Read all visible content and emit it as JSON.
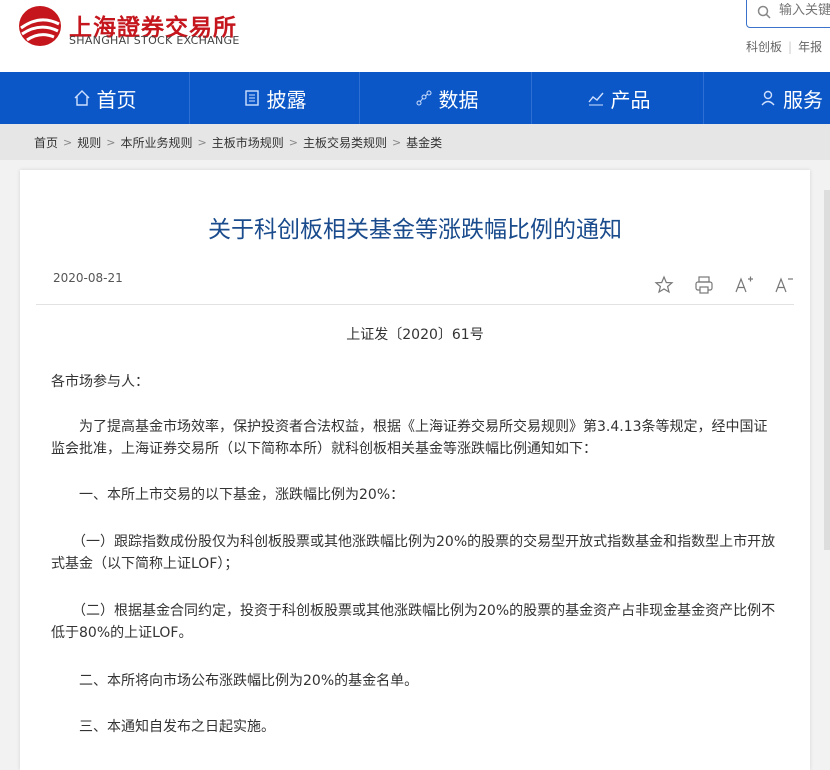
{
  "header": {
    "logo_cn": "上海證券交易所",
    "logo_en": "SHANGHAI STOCK EXCHANGE",
    "search_placeholder": "输入关键",
    "quick_links": [
      "科创板",
      "年报"
    ]
  },
  "nav": {
    "items": [
      {
        "label": "首页",
        "icon": "home-icon"
      },
      {
        "label": "披露",
        "icon": "document-icon"
      },
      {
        "label": "数据",
        "icon": "data-icon"
      },
      {
        "label": "产品",
        "icon": "chart-icon"
      },
      {
        "label": "服务",
        "icon": "user-service-icon"
      }
    ]
  },
  "breadcrumb": [
    "首页",
    "规则",
    "本所业务规则",
    "主板市场规则",
    "主板交易类规则",
    "基金类"
  ],
  "article": {
    "title": "关于科创板相关基金等涨跌幅比例的通知",
    "date": "2020-08-21",
    "doc_number": "上证发〔2020〕61号",
    "paragraphs": [
      "各市场参与人：",
      "　　为了提高基金市场效率，保护投资者合法权益，根据《上海证券交易所交易规则》第3.4.13条等规定，经中国证监会批准，上海证券交易所（以下简称本所）就科创板相关基金等涨跌幅比例通知如下：",
      "　　一、本所上市交易的以下基金，涨跌幅比例为20%：",
      "　　（一）跟踪指数成份股仅为科创板股票或其他涨跌幅比例为20%的股票的交易型开放式指数基金和指数型上市开放式基金（以下简称上证LOF）；",
      "　　（二）根据基金合同约定，投资于科创板股票或其他涨跌幅比例为20%的股票的基金资产占非现金基金资产比例不低于80%的上证LOF。",
      "　　二、本所将向市场公布涨跌幅比例为20%的基金名单。",
      "　　三、本通知自发布之日起实施。"
    ]
  },
  "colors": {
    "brand_red": "#c4161c",
    "nav_blue": "#0b57c8",
    "title_blue": "#1a4b8c"
  }
}
